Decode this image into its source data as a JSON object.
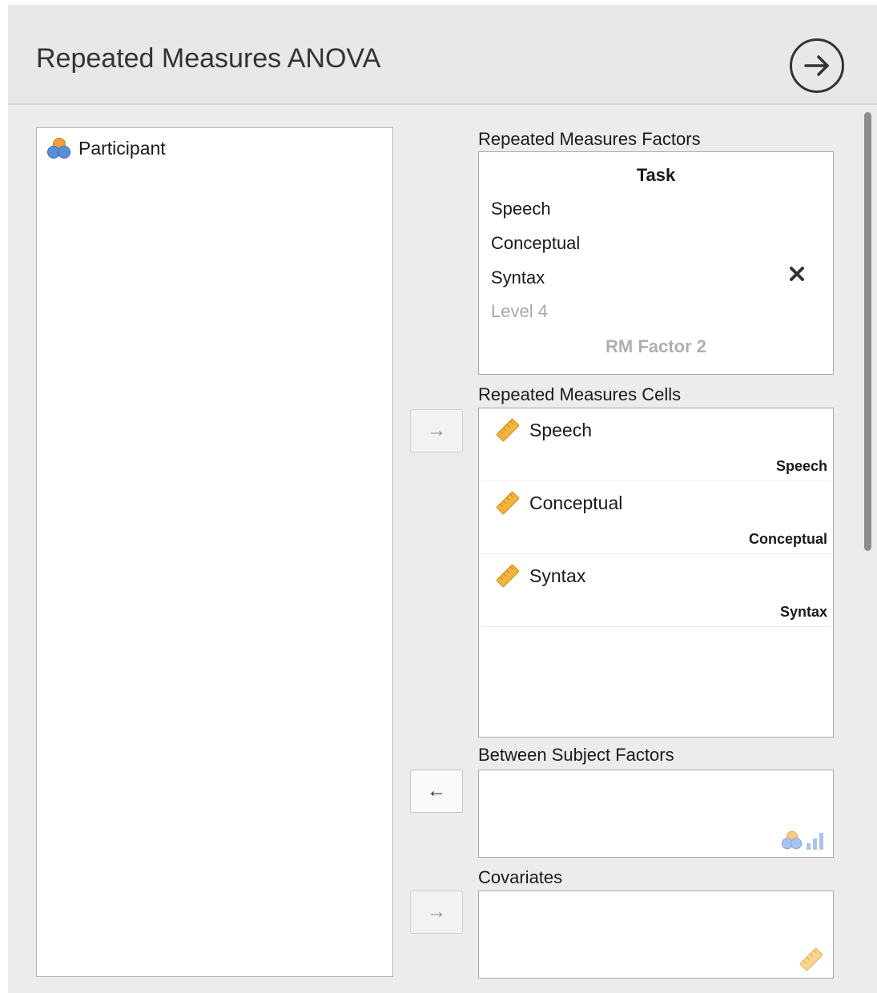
{
  "dialog": {
    "title": "Repeated Measures ANOVA",
    "run_icon": "arrow-circle-right-icon"
  },
  "variables": [
    {
      "name": "Participant",
      "icon": "nominal-variable-icon"
    }
  ],
  "rm_factors": {
    "label": "Repeated Measures Factors",
    "factor_name": "Task",
    "levels": [
      "Speech",
      "Conceptual",
      "Syntax"
    ],
    "level_placeholder": "Level 4",
    "factor_placeholder": "RM Factor 2",
    "remove_icon": "close-x-icon"
  },
  "rm_cells": {
    "label": "Repeated Measures Cells",
    "cells": [
      {
        "variable": "Speech",
        "level": "Speech",
        "icon": "scale-variable-icon"
      },
      {
        "variable": "Conceptual",
        "level": "Conceptual",
        "icon": "scale-variable-icon"
      },
      {
        "variable": "Syntax",
        "level": "Syntax",
        "icon": "scale-variable-icon"
      }
    ]
  },
  "between_subject": {
    "label": "Between Subject Factors",
    "hint_icons": [
      "nominal-variable-icon",
      "ordinal-variable-icon"
    ]
  },
  "covariates": {
    "label": "Covariates",
    "hint_icons": [
      "scale-variable-icon"
    ]
  },
  "buttons": {
    "assign_cells": "→",
    "unassign_between": "←",
    "assign_covariates": "→"
  },
  "colors": {
    "nominal_orange": "#f0a23a",
    "nominal_blue": "#5a8fd8",
    "scale_yellow": "#f2b43c",
    "ordinal_blue": "#6ea0e0"
  }
}
